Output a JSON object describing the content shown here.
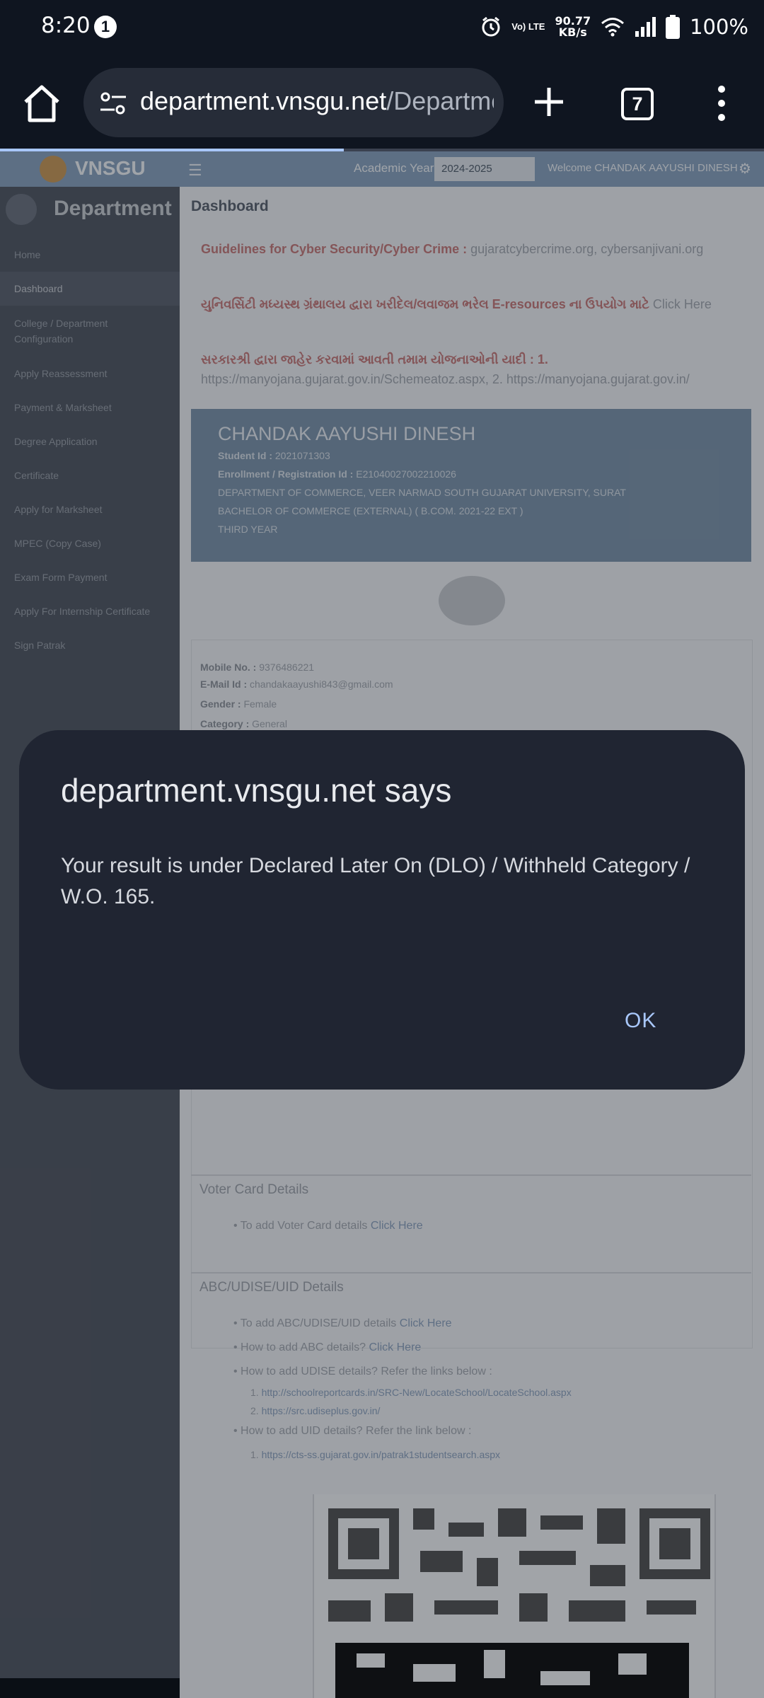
{
  "status_bar": {
    "time": "8:20",
    "notification_count": "1",
    "volte": "Vo) LTE",
    "net_speed_value": "90.77",
    "net_speed_unit": "KB/s",
    "battery": "100%"
  },
  "browser": {
    "url_host": "department.vnsgu.net",
    "url_path": "/Departme",
    "tab_count": "7",
    "load_progress_fraction": 0.45,
    "accent_color": "#a8c7fa"
  },
  "page": {
    "logo_text": "VNSGU",
    "academic_year_label": "Academic Year:",
    "academic_year_value": "2024-2025",
    "welcome_text": "Welcome CHANDAK AAYUSHI DINESH",
    "sidebar_title": "Department",
    "sidebar_items": [
      "Home",
      "Dashboard",
      "College / Department Configuration",
      "Apply Reassessment",
      "Payment & Marksheet",
      "Degree Application",
      "Certificate",
      "Apply for Marksheet",
      "MPEC (Copy Case)",
      "Exam Form Payment",
      "Apply For Internship Certificate",
      "Sign Patrak"
    ],
    "content_title": "Dashboard",
    "notices": [
      {
        "bold": "Guidelines for Cyber Security/Cyber Crime :",
        "rest": "gujaratcybercrime.org, cybersanjivani.org"
      },
      {
        "bold": "યુનિવર્સિટી મધ્યસ્થ ગ્રંથાલય દ્વારા ખરીદેલ/લવાજમ ભરેલ E-resources ના ઉપયોગ માટે",
        "rest": "Click Here"
      },
      {
        "bold": "સરકારશ્રી દ્વારા જાહેર કરવામાં આવતી તમામ યોજનાઓની યાદી : 1.",
        "rest": "https://manyojana.gujarat.gov.in/Schemeatoz.aspx, 2. https://manyojana.gujarat.gov.in/"
      }
    ],
    "student": {
      "name": "CHANDAK AAYUSHI DINESH",
      "student_id_label": "Student Id :",
      "student_id": "2021071303",
      "enrollment_label": "Enrollment / Registration Id :",
      "enrollment": "E21040027002210026",
      "department": "DEPARTMENT OF COMMERCE, VEER NARMAD SOUTH GUJARAT UNIVERSITY, SURAT",
      "course": "BACHELOR OF COMMERCE (EXTERNAL) ( B.COM. 2021-22 EXT )",
      "year": "THIRD YEAR"
    },
    "contact": {
      "mobile_label": "Mobile No. :",
      "mobile": "9376486221",
      "email_label": "E-Mail Id :",
      "email": "chandakaayushi843@gmail.com",
      "gender_label": "Gender :",
      "gender": "Female",
      "category_label": "Category :",
      "category": "General"
    },
    "voter_section": {
      "title": "Voter Card Details",
      "item": "To add Voter Card details",
      "link": "Click Here"
    },
    "abc_section": {
      "title": "ABC/UDISE/UID Details",
      "items": [
        {
          "text": "To add ABC/UDISE/UID details",
          "link": "Click Here"
        },
        {
          "text": "How to add ABC details?",
          "link": "Click Here"
        },
        {
          "text": "How to add UDISE details? Refer the links below :",
          "link": ""
        },
        {
          "text": "1.",
          "link": "http://schoolreportcards.in/SRC-New/LocateSchool/LocateSchool.aspx"
        },
        {
          "text": "2.",
          "link": "https://src.udiseplus.gov.in/"
        },
        {
          "text": "How to add UID details? Refer the link below :",
          "link": ""
        },
        {
          "text": "1.",
          "link": "https://cts-ss.gujarat.gov.in/patrak1studentsearch.aspx"
        }
      ]
    }
  },
  "dialog": {
    "title": "department.vnsgu.net says",
    "message": "Your result is under Declared Later On (DLO) / Withheld Category / W.O. 165.",
    "ok_label": "OK"
  }
}
